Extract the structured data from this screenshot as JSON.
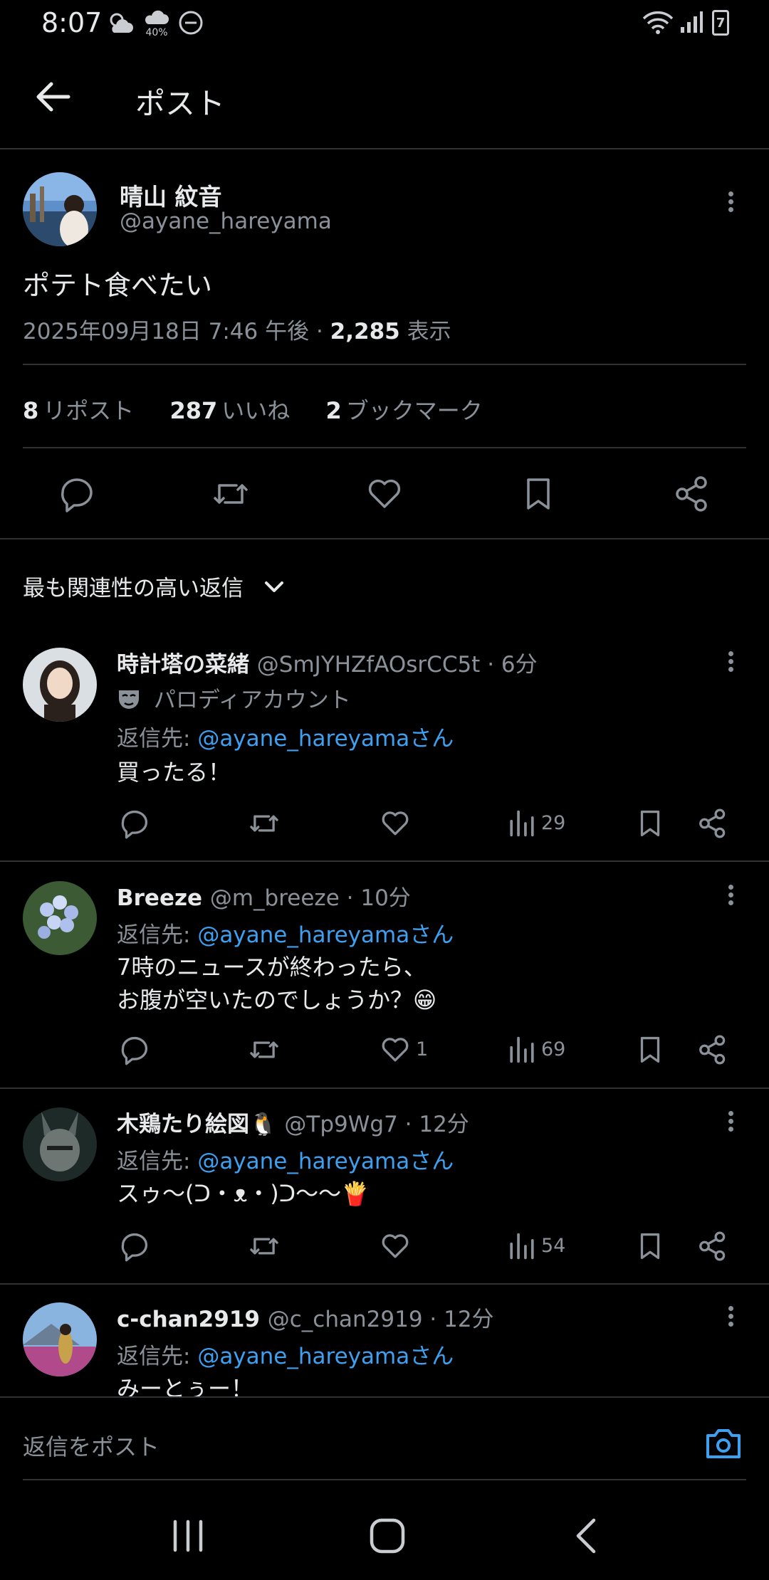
{
  "status_bar": {
    "time": "8:07",
    "weather_percent": "40%",
    "battery_level": "7"
  },
  "header": {
    "title": "ポスト",
    "back_icon": "arrow-left-icon"
  },
  "post": {
    "author_name": "晴山 紋音",
    "author_handle": "@ayane_hareyama",
    "text": "ポテト食べたい",
    "date": "2025年09月18日 7:46 午後",
    "separator": " · ",
    "views": "2,285",
    "views_label": " 表示",
    "stats": {
      "reposts": "8",
      "reposts_label": "リポスト",
      "likes": "287",
      "likes_label": "いいね",
      "bookmarks": "2",
      "bookmarks_label": "ブックマーク"
    },
    "actions": [
      "reply-icon",
      "repost-icon",
      "like-icon",
      "bookmark-icon",
      "share-icon"
    ]
  },
  "replies_sort": {
    "label": "最も関連性の高い返信"
  },
  "replies": [
    {
      "name": "時計塔の菜緒",
      "handle": "@SmJYHZfAOsrCC5t",
      "time": "6分",
      "parody_label": "パロディアカウント",
      "reply_to_prefix": "返信先: ",
      "reply_to": "@ayane_hareyamaさん",
      "body_lines": [
        "買ったる！"
      ],
      "likes": "",
      "views": "29"
    },
    {
      "name": "Breeze",
      "handle": "@m_breeze",
      "time": "10分",
      "reply_to_prefix": "返信先: ",
      "reply_to": "@ayane_hareyamaさん",
      "body_lines": [
        "7時のニュースが終わったら、",
        "お腹が空いたのでしょうか？😁"
      ],
      "likes": "1",
      "views": "69"
    },
    {
      "name": "木鶏たり絵図🐧",
      "handle": "@Tp9Wg7",
      "time": "12分",
      "reply_to_prefix": "返信先: ",
      "reply_to": "@ayane_hareyamaさん",
      "body_lines": [
        "スゥ〜(ᑐ・ᴥ・)ᑐ〜〜🍟"
      ],
      "likes": "",
      "views": "54"
    },
    {
      "name": "c-chan2919",
      "handle": "@c_chan2919",
      "time": "12分",
      "reply_to_prefix": "返信先: ",
      "reply_to": "@ayane_hareyamaさん",
      "body_lines": [
        "みーとぅー！"
      ],
      "likes": "",
      "views": ""
    }
  ],
  "compose": {
    "placeholder": "返信をポスト"
  },
  "colors": {
    "background": "#000000",
    "text": "#e7e9ea",
    "muted": "#8b9199",
    "link": "#3ea0f0",
    "divider": "#2f3336"
  }
}
